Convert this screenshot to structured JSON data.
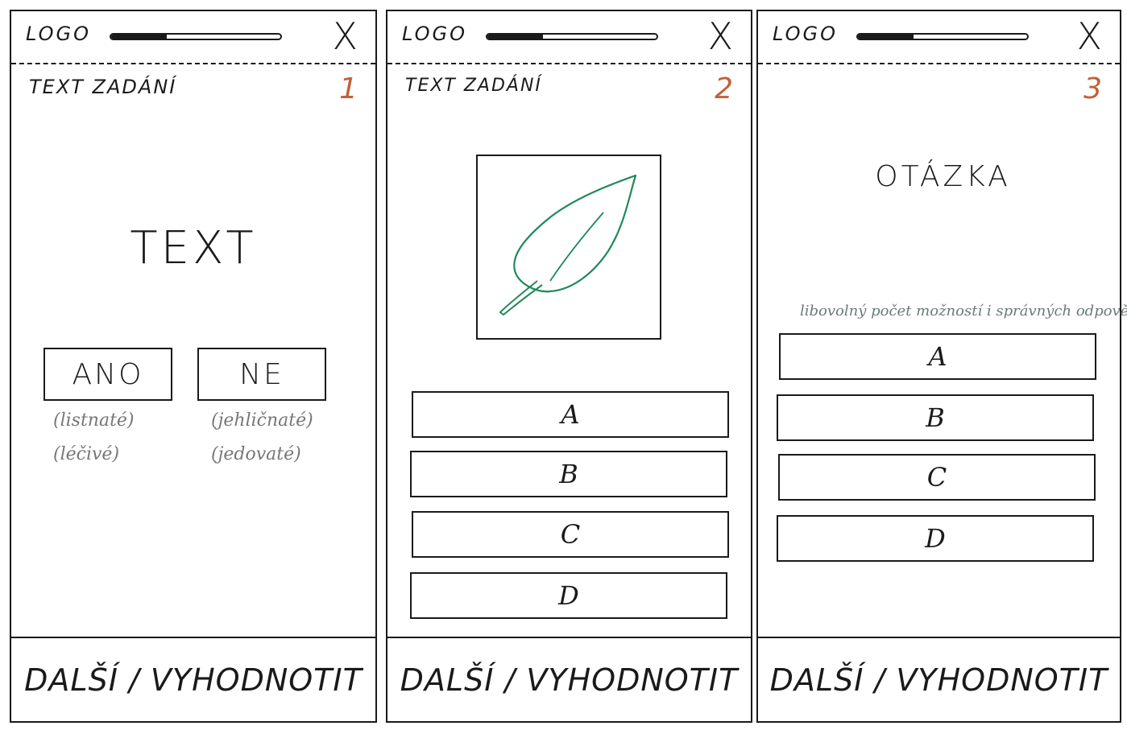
{
  "header": {
    "logo": "LOGO",
    "close_glyph": "X",
    "task_label": "TEXT ZADÁNÍ"
  },
  "footer": {
    "action_label": "DALŠÍ / VYHODNOTIT"
  },
  "screens": [
    {
      "step": "1",
      "progress_fraction": 0.33,
      "main_text": "TEXT",
      "yes_button": "ANO",
      "no_button": "NE",
      "yes_hints": [
        "(listnaté)",
        "(léčivé)"
      ],
      "no_hints": [
        "(jehličnaté)",
        "(jedovaté)"
      ]
    },
    {
      "step": "2",
      "progress_fraction": 0.33,
      "image_icon": "leaf-icon",
      "options": [
        "A",
        "B",
        "C",
        "D"
      ]
    },
    {
      "step": "3",
      "progress_fraction": 0.33,
      "question": "OTÁZKA",
      "note": "libovolný počet možností i správných odpovědí",
      "options": [
        "A",
        "B",
        "C",
        "D"
      ]
    }
  ],
  "colors": {
    "ink": "#1a1a1a",
    "step_number": "#c0623a",
    "leaf": "#1f8a5a",
    "hint": "#777777"
  }
}
